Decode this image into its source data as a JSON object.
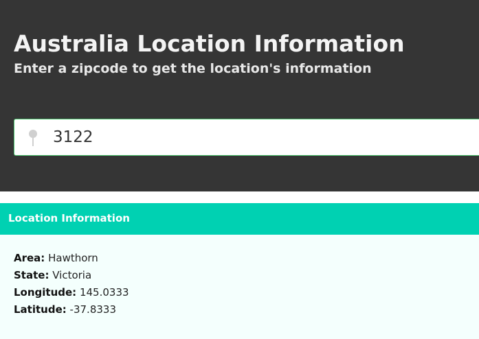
{
  "hero": {
    "title": "Australia Location Information",
    "subtitle": "Enter a zipcode to get the location's information"
  },
  "search": {
    "icon": "map-pin-icon",
    "value": "3122"
  },
  "info": {
    "header": "Location Information",
    "rows": [
      {
        "label": "Area:",
        "value": "Hawthorn"
      },
      {
        "label": "State:",
        "value": "Victoria"
      },
      {
        "label": "Longitude:",
        "value": "145.0333"
      },
      {
        "label": "Latitude:",
        "value": "-37.8333"
      }
    ]
  },
  "colors": {
    "hero_bg": "#353535",
    "accent": "#00d1b2",
    "input_border": "#49c46b",
    "panel_bg": "#f4fffd"
  }
}
